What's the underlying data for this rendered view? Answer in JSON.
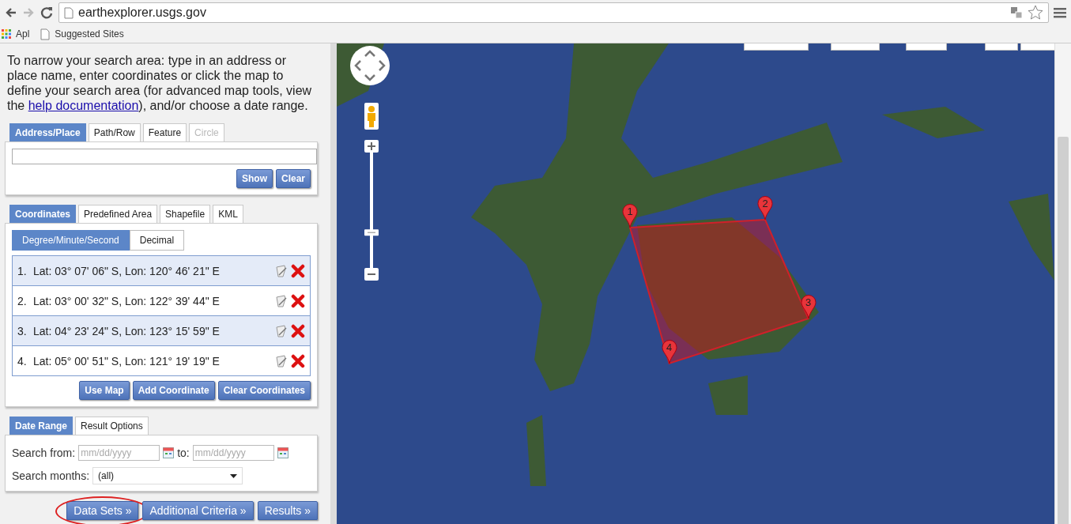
{
  "browser": {
    "url": "earthexplorer.usgs.gov",
    "bookmarks": [
      {
        "label": "Apl",
        "kind": "apps"
      },
      {
        "label": "Suggested Sites",
        "kind": "page"
      }
    ]
  },
  "intro": {
    "before": "To narrow your search area: type in an address or place name, enter coordinates or click the map to define your search area (for advanced map tools, view the ",
    "link": "help documentation",
    "after": "), and/or choose a date range."
  },
  "location_tabs": [
    {
      "label": "Address/Place",
      "selected": true,
      "disabled": false
    },
    {
      "label": "Path/Row",
      "selected": false,
      "disabled": false
    },
    {
      "label": "Feature",
      "selected": false,
      "disabled": false
    },
    {
      "label": "Circle",
      "selected": false,
      "disabled": true
    }
  ],
  "address_buttons": [
    "Show",
    "Clear"
  ],
  "area_tabs": [
    {
      "label": "Coordinates",
      "selected": true
    },
    {
      "label": "Predefined Area",
      "selected": false
    },
    {
      "label": "Shapefile",
      "selected": false
    },
    {
      "label": "KML",
      "selected": false
    }
  ],
  "format_toggle": [
    {
      "label": "Degree/Minute/Second",
      "selected": true
    },
    {
      "label": "Decimal",
      "selected": false
    }
  ],
  "coordinates": [
    {
      "number": "1.",
      "text": "Lat: 03° 07' 06\" S, Lon: 120° 46' 21\" E"
    },
    {
      "number": "2.",
      "text": "Lat: 03° 00' 32\" S, Lon: 122° 39' 44\" E"
    },
    {
      "number": "3.",
      "text": "Lat: 04° 23' 24\" S, Lon: 123° 15' 59\" E"
    },
    {
      "number": "4.",
      "text": "Lat: 05° 00' 51\" S, Lon: 121° 19' 19\" E"
    }
  ],
  "coordinate_buttons": [
    "Use Map",
    "Add Coordinate",
    "Clear Coordinates"
  ],
  "option_tabs": [
    {
      "label": "Date Range",
      "selected": true
    },
    {
      "label": "Result Options",
      "selected": false
    }
  ],
  "date": {
    "from_label": "Search from:",
    "from_placeholder": "mm/dd/yyyy",
    "to_label": "to:",
    "to_placeholder": "mm/dd/yyyy",
    "months_label": "Search months:",
    "months_value": "(all)"
  },
  "nav_buttons": [
    {
      "label": "Data Sets »",
      "circled": true
    },
    {
      "label": "Additional Criteria »",
      "circled": false
    },
    {
      "label": "Results »",
      "circled": false
    }
  ],
  "map": {
    "zoom": {
      "level": 0.3
    },
    "markers": [
      {
        "label": "1"
      },
      {
        "label": "2"
      },
      {
        "label": "3"
      },
      {
        "label": "4"
      }
    ]
  }
}
